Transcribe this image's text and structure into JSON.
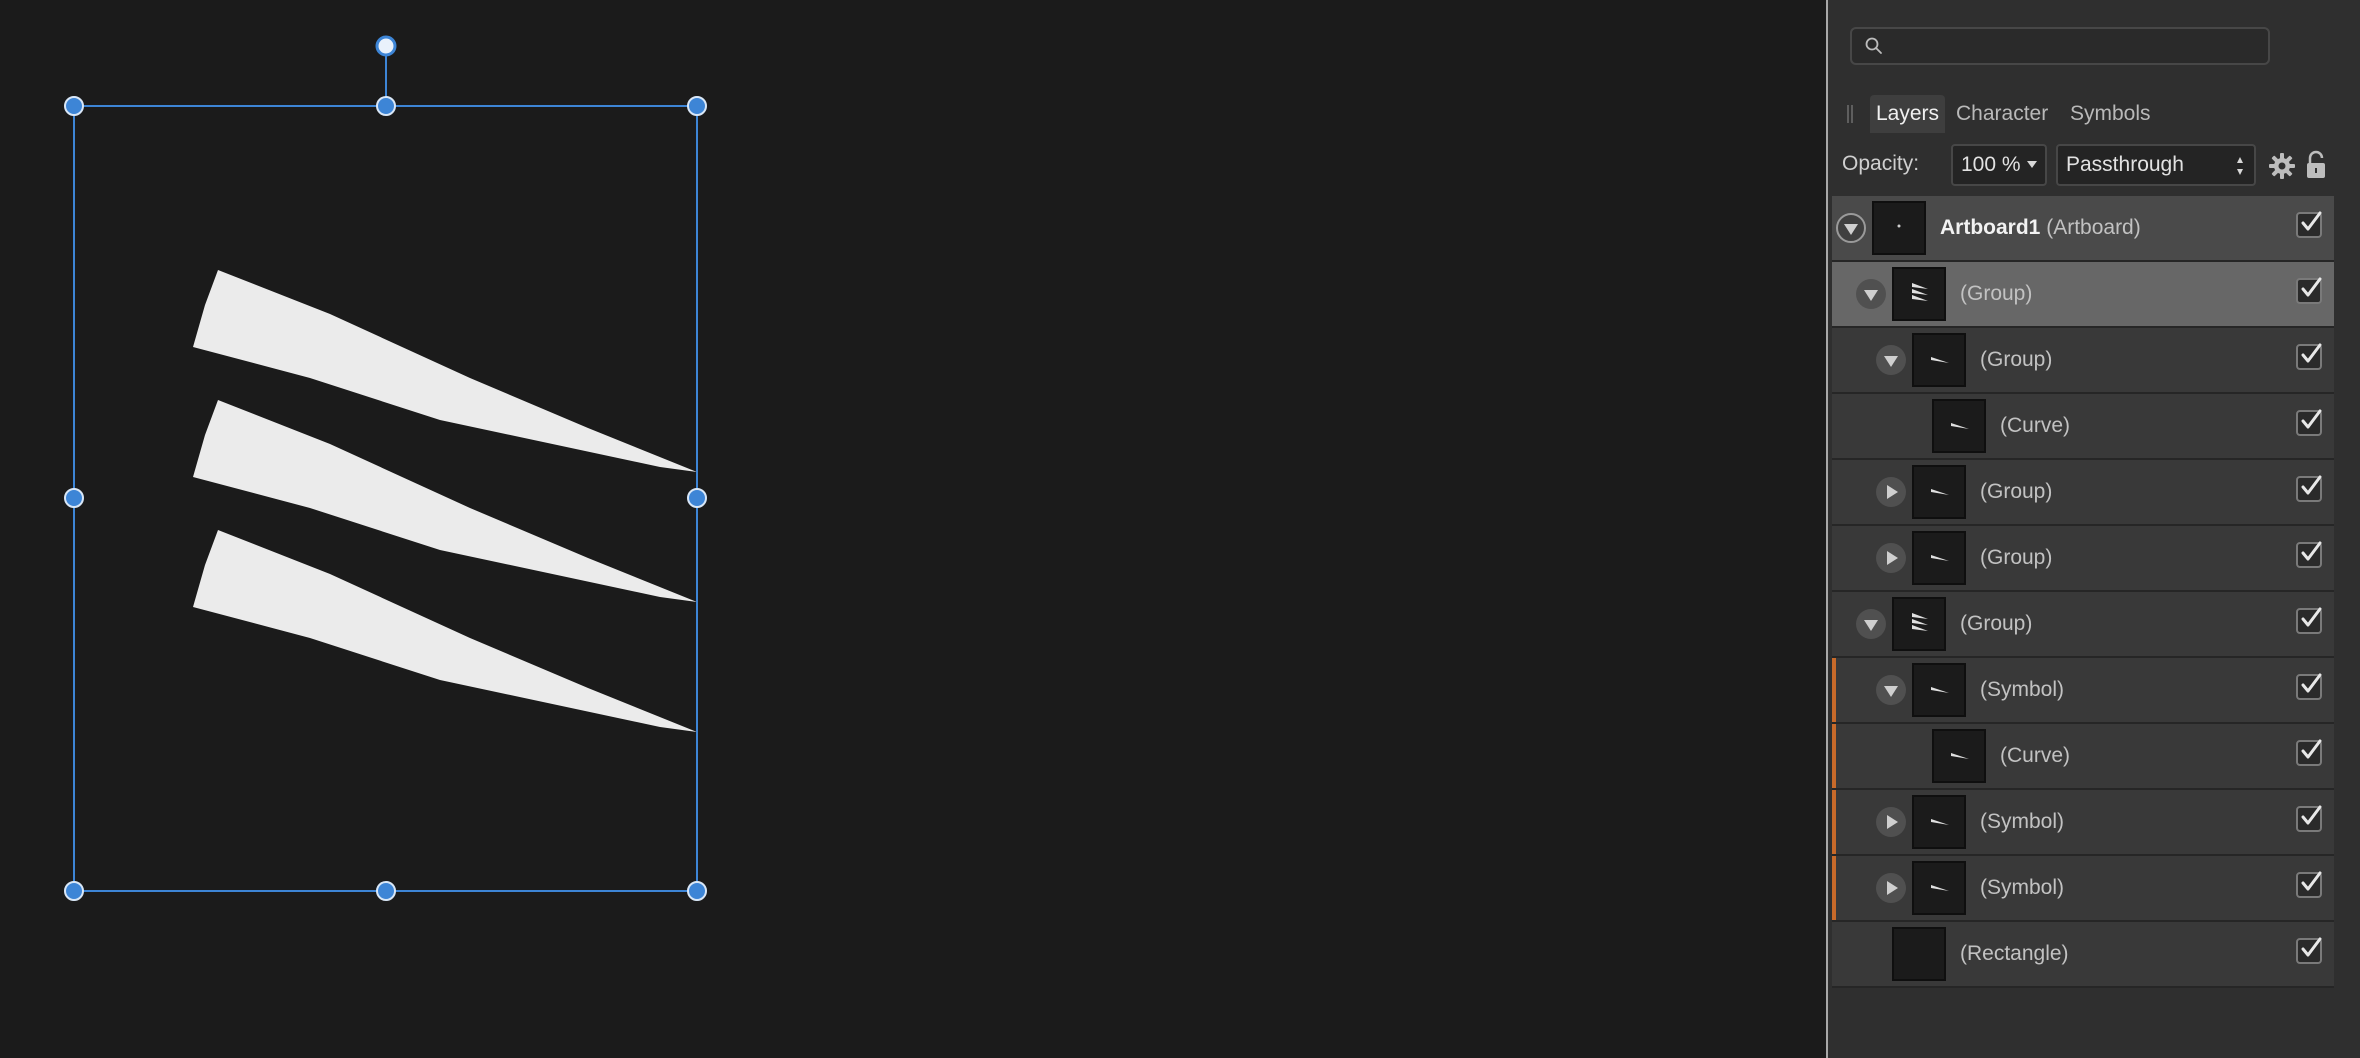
{
  "search": {
    "placeholder": "",
    "value": ""
  },
  "tabs": [
    {
      "label": "Layers",
      "active": true
    },
    {
      "label": "Character",
      "active": false
    },
    {
      "label": "Symbols",
      "active": false
    }
  ],
  "opacity": {
    "label": "Opacity:",
    "value": "100 %"
  },
  "blend_mode": {
    "value": "Passthrough"
  },
  "layers": [
    {
      "name": "Artboard1",
      "type": "(Artboard)",
      "depth": 0,
      "expander": "expanded-root",
      "selected": "root",
      "symbol_marker": false,
      "visible": true
    },
    {
      "name": "",
      "type": "(Group)",
      "depth": 1,
      "expander": "expanded",
      "selected": "selected",
      "symbol_marker": false,
      "visible": true
    },
    {
      "name": "",
      "type": "(Group)",
      "depth": 2,
      "expander": "expanded",
      "selected": "",
      "symbol_marker": false,
      "visible": true
    },
    {
      "name": "",
      "type": "(Curve)",
      "depth": 3,
      "expander": "none",
      "selected": "",
      "symbol_marker": false,
      "visible": true
    },
    {
      "name": "",
      "type": "(Group)",
      "depth": 2,
      "expander": "collapsed",
      "selected": "",
      "symbol_marker": false,
      "visible": true
    },
    {
      "name": "",
      "type": "(Group)",
      "depth": 2,
      "expander": "collapsed",
      "selected": "",
      "symbol_marker": false,
      "visible": true
    },
    {
      "name": "",
      "type": "(Group)",
      "depth": 1,
      "expander": "expanded",
      "selected": "",
      "symbol_marker": false,
      "visible": true
    },
    {
      "name": "",
      "type": "(Symbol)",
      "depth": 2,
      "expander": "expanded",
      "selected": "",
      "symbol_marker": true,
      "visible": true
    },
    {
      "name": "",
      "type": "(Curve)",
      "depth": 3,
      "expander": "none",
      "selected": "",
      "symbol_marker": true,
      "visible": true
    },
    {
      "name": "",
      "type": "(Symbol)",
      "depth": 2,
      "expander": "collapsed",
      "selected": "",
      "symbol_marker": true,
      "visible": true
    },
    {
      "name": "",
      "type": "(Symbol)",
      "depth": 2,
      "expander": "collapsed",
      "selected": "",
      "symbol_marker": true,
      "visible": true
    },
    {
      "name": "",
      "type": "(Rectangle)",
      "depth": 1,
      "expander": "none",
      "selected": "",
      "symbol_marker": false,
      "visible": true
    }
  ],
  "colors": {
    "canvas_bg": "#1b1b1b",
    "selection": "#3d85d6",
    "shape_fill": "#ebebeb",
    "symbol_marker": "#c86a2a",
    "panel_bg": "#2f2f2f"
  }
}
